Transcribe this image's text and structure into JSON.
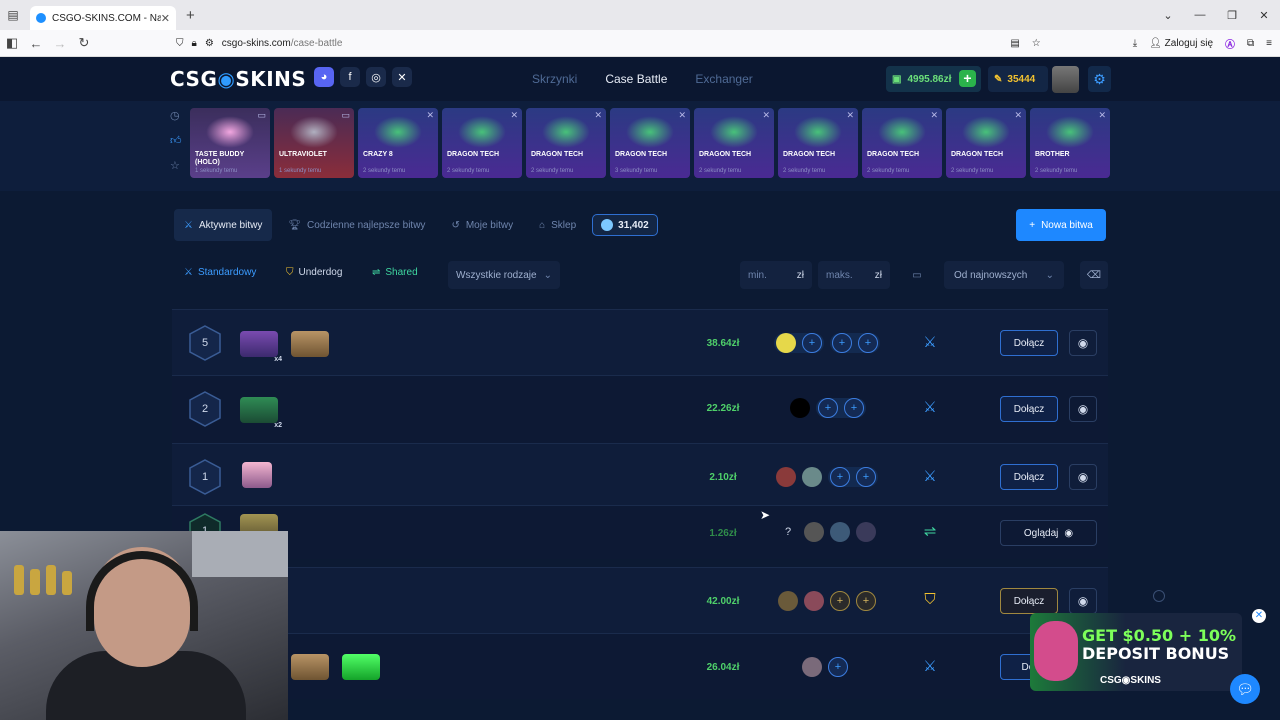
{
  "browser": {
    "tab_title": "CSGO-SKINS.COM - Najlepsze",
    "url_domain": "csgo-skins.com",
    "url_path": "/case-battle",
    "login_label": "Zaloguj się"
  },
  "header": {
    "logo_left": "CSG",
    "logo_right": "SKINS",
    "nav": [
      "Skrzynki",
      "Case Battle",
      "Exchanger"
    ],
    "balance": "4995.86zł",
    "coins": "35444"
  },
  "drops": [
    {
      "name": "TASTE BUDDY (HOLO)",
      "time": "1 sekundy temu",
      "style": "gold"
    },
    {
      "name": "ULTRAVIOLET",
      "time": "1 sekundy temu",
      "style": "red"
    },
    {
      "name": "CRAZY 8",
      "time": "2 sekundy temu",
      "style": "blue"
    },
    {
      "name": "DRAGON TECH",
      "time": "2 sekundy temu",
      "style": "blue"
    },
    {
      "name": "DRAGON TECH",
      "time": "2 sekundy temu",
      "style": "blue"
    },
    {
      "name": "DRAGON TECH",
      "time": "3 sekundy temu",
      "style": "blue"
    },
    {
      "name": "DRAGON TECH",
      "time": "2 sekundy temu",
      "style": "blue"
    },
    {
      "name": "DRAGON TECH",
      "time": "2 sekundy temu",
      "style": "blue"
    },
    {
      "name": "DRAGON TECH",
      "time": "2 sekundy temu",
      "style": "blue"
    },
    {
      "name": "DRAGON TECH",
      "time": "2 sekundy temu",
      "style": "blue"
    },
    {
      "name": "BROTHER",
      "time": "2 sekundy temu",
      "style": "blue"
    }
  ],
  "tabs": {
    "active": "Aktywne bitwy",
    "daily": "Codzienne najlepsze bitwy",
    "mine": "Moje bitwy",
    "shop": "Sklep",
    "gems": "31,402",
    "new_battle": "Nowa bitwa"
  },
  "filters": {
    "standard": "Standardowy",
    "underdog": "Underdog",
    "shared": "Shared",
    "all_types": "Wszystkie rodzaje",
    "min": "min.",
    "max": "maks.",
    "currency": "zł",
    "sort": "Od najnowszych"
  },
  "battles": [
    {
      "round": "5",
      "price": "38.64zł",
      "join": "Dołącz"
    },
    {
      "round": "2",
      "price": "22.26zł",
      "join": "Dołącz"
    },
    {
      "round": "1",
      "price": "2.10zł",
      "join": "Dołącz"
    },
    {
      "round": "1",
      "price": "1.26zł",
      "watch": "Oglądaj",
      "unknown": "?"
    },
    {
      "price": "42.00zł",
      "join": "Dołącz"
    },
    {
      "price": "26.04zł",
      "join": "Doł"
    }
  ],
  "case_counts": {
    "row1": "x4",
    "row2": "x2"
  },
  "promo": {
    "line1": "GET $0.50 + 10%",
    "line2": "DEPOSIT BONUS",
    "brand": "CSG◉SKINS"
  },
  "colors": {
    "accent": "#1e88ff",
    "price": "#4fd06a",
    "gold": "#f2c230",
    "shared": "#3fd6a0",
    "bg": "#0c1a33"
  }
}
